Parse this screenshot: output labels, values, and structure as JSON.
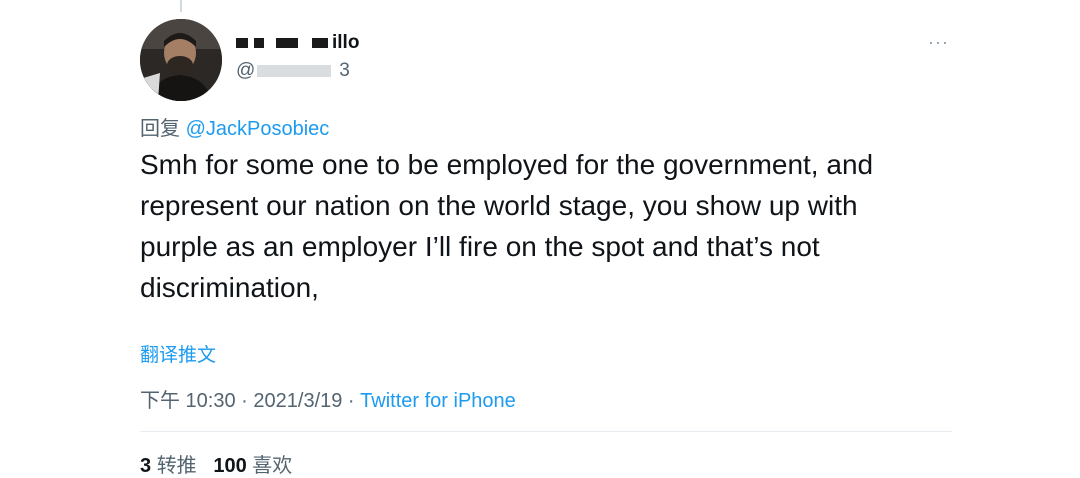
{
  "author": {
    "display_name_suffix": "illo",
    "handle_prefix": "@",
    "handle_suffix": "3"
  },
  "more_icon": "more-icon",
  "reply_to": {
    "prefix": "回复",
    "mention": "@JackPosobiec"
  },
  "tweet": {
    "lines": [
      "Smh for some one to be employed for the government, and",
      "represent our nation on the world stage, you show up with",
      "purple as an employer I’ll fire on the spot and that’s not",
      "discrimination,"
    ]
  },
  "translate_label": "翻译推文",
  "meta": {
    "time": "下午 10:30",
    "sep1": " · ",
    "date": "2021/3/19",
    "sep2": " · ",
    "source": "Twitter for iPhone"
  },
  "stats": {
    "retweets_count": "3",
    "retweets_label": "转推",
    "likes_count": "100",
    "likes_label": "喜欢"
  },
  "colors": {
    "link": "#1d9bf0",
    "secondary": "#536471",
    "text": "#0f1419"
  }
}
